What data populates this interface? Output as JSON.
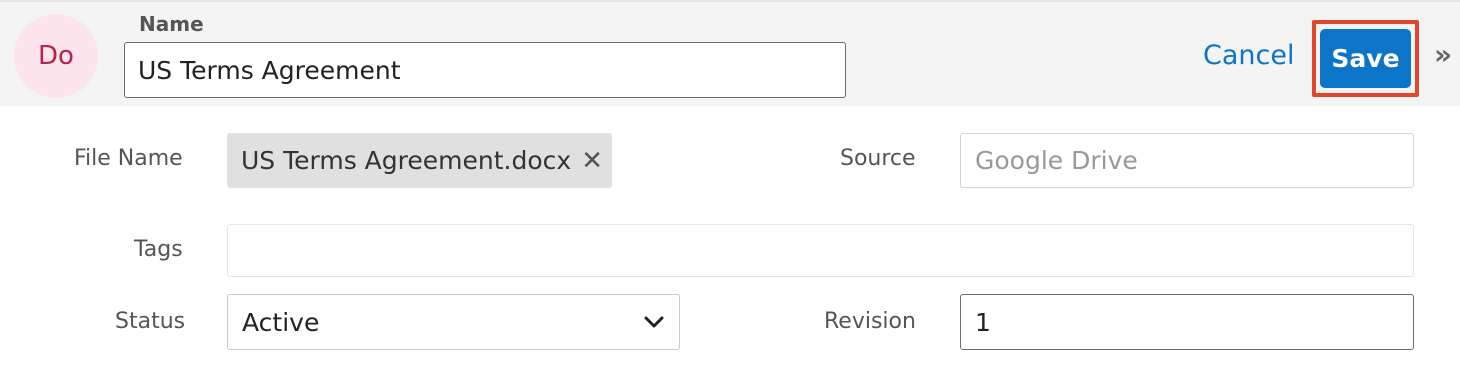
{
  "header": {
    "avatar_initials": "Do",
    "name_label": "Name",
    "name_value": "US Terms Agreement",
    "cancel_label": "Cancel",
    "save_label": "Save",
    "expand_glyph": "»"
  },
  "fields": {
    "file_name": {
      "label": "File Name",
      "value": "US Terms Agreement.docx",
      "remove_glyph": "✕"
    },
    "source": {
      "label": "Source",
      "placeholder": "Google Drive"
    },
    "tags": {
      "label": "Tags",
      "value": ""
    },
    "status": {
      "label": "Status",
      "value": "Active"
    },
    "revision": {
      "label": "Revision",
      "value": "1"
    }
  },
  "icons": {
    "expand": "double-chevron-right-icon",
    "remove": "close-icon",
    "dropdown": "chevron-down-icon"
  },
  "colors": {
    "accent": "#0c75c8",
    "highlight": "#e2462f",
    "avatar_bg": "#fce4ec",
    "avatar_fg": "#b0264e"
  }
}
